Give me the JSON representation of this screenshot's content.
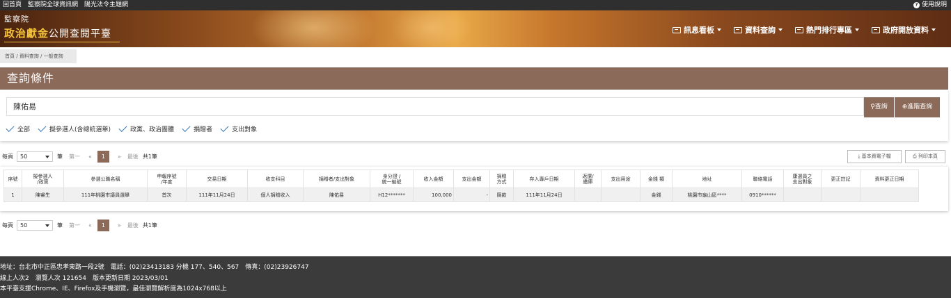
{
  "topbar": {
    "links": [
      "回首頁",
      "監察院全球資訊網",
      "陽光法令主題網"
    ],
    "help": "使用說明"
  },
  "header": {
    "org": "監察院",
    "title_highlight": "政治獻金",
    "title_rest": "公開查閱平臺",
    "nav": [
      "訊息看板",
      "資料查詢",
      "熱門排行專區",
      "政府開放資料"
    ]
  },
  "breadcrumb": [
    "首頁",
    "資料查詢",
    "一般查詢"
  ],
  "query": {
    "title": "查詢條件",
    "search_value": "陳佑易",
    "search_button": "查詢",
    "advanced_button": "進階查詢",
    "filters": [
      "全部",
      "擬參選人(含總統選舉)",
      "政黨、政治團體",
      "捐贈者",
      "支出對象"
    ]
  },
  "pager": {
    "per_page_label": "每頁",
    "per_page_value": "50",
    "unit": "筆",
    "first": "第一",
    "prev": "«",
    "current_page": "1",
    "next": "»",
    "last": "最後",
    "total": "共1筆"
  },
  "tools": {
    "basic_data": "基本資電子檔",
    "print": "列印本頁"
  },
  "table": {
    "headers": [
      "序號",
      "擬參選人\n/政黨",
      "參選公職名稱",
      "申報序號\n/年度",
      "交易日期",
      "收支科目",
      "捐贈者/支出對象",
      "身分證 /\n統一編號",
      "收入金額",
      "支出金額",
      "捐贈\n方式",
      "存入專戶日期",
      "返還/\n繳庫",
      "支出用途",
      "金錢 類",
      "地址",
      "聯絡電話",
      "康選員之\n支出對象",
      "更正註記",
      "資料更正日期"
    ],
    "rows": [
      [
        "1",
        "陳睿生",
        "111年桃園市議員選舉",
        "首次",
        "111年11月24日",
        "個人捐贈收入",
        "陳佑易",
        "H12*******",
        "100,000",
        "-",
        "匯款",
        "111年11月24日",
        "",
        "",
        "金錢",
        "桃園市龜山區****",
        "0910******",
        "",
        "",
        ""
      ]
    ]
  },
  "footer": {
    "line1": "地址：台北市中正區忠孝東路一段2號　電話：(02)23413183 分機 177、540、567　傳真：(02)23926747",
    "line2": "線上人次2　瀏覽人次 121654　版本更新日期 2023/03/01",
    "line3": "本平臺支援Chrome、IE、Firefox及手機瀏覽，最佳瀏覽解析度為1024x768以上"
  }
}
